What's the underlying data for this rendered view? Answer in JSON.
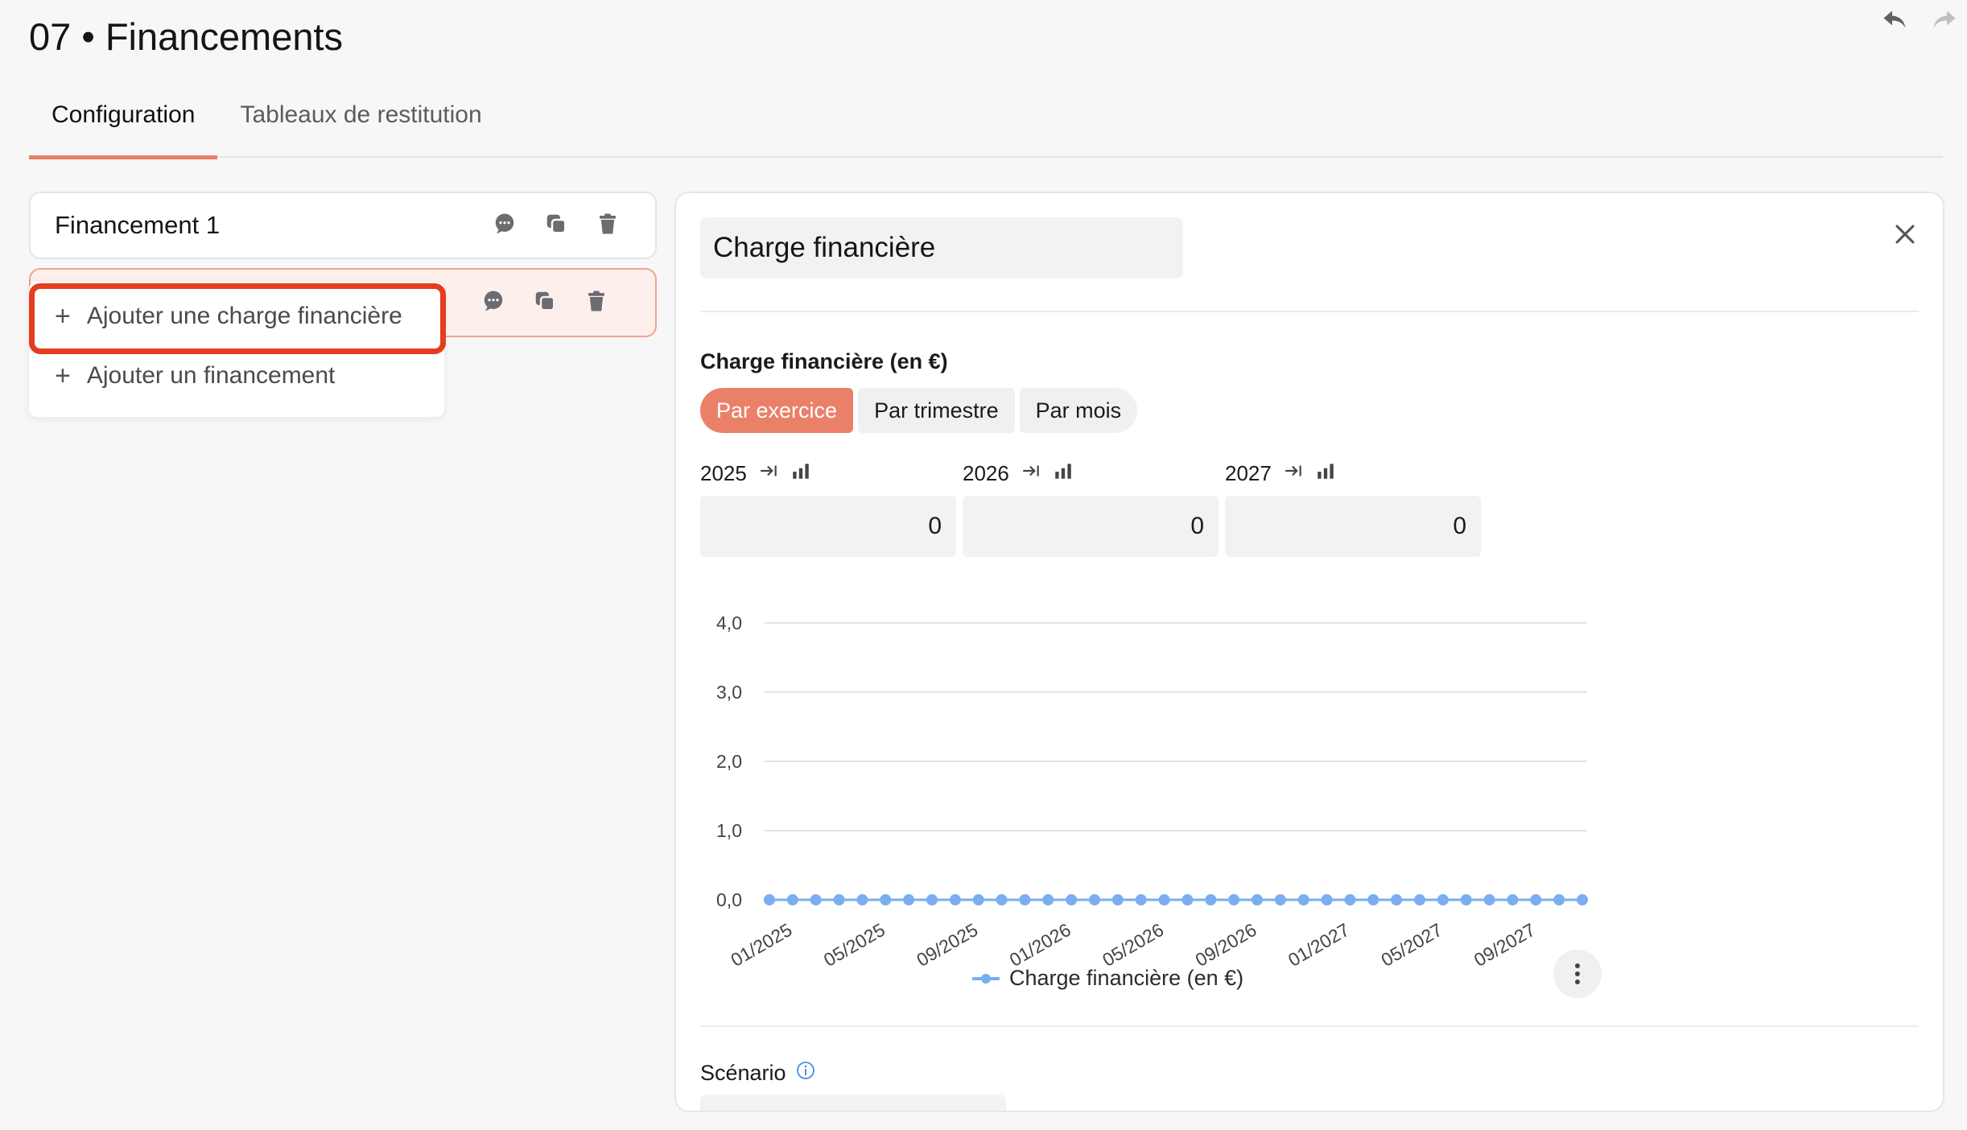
{
  "page": {
    "title": "07 • Financements"
  },
  "tabs": [
    {
      "label": "Configuration",
      "active": true
    },
    {
      "label": "Tableaux de restitution",
      "active": false
    }
  ],
  "financements": [
    {
      "name": "Financement 1"
    }
  ],
  "dropdown": {
    "items": [
      {
        "label": "Ajouter une charge financière"
      },
      {
        "label": "Ajouter un financement"
      }
    ]
  },
  "detail": {
    "name_value": "Charge financière",
    "section_label": "Charge financière (en €)",
    "periods": [
      {
        "label": "Par exercice",
        "active": true
      },
      {
        "label": "Par trimestre",
        "active": false
      },
      {
        "label": "Par mois",
        "active": false
      }
    ],
    "years": [
      {
        "year": "2025",
        "value": "0"
      },
      {
        "year": "2026",
        "value": "0"
      },
      {
        "year": "2027",
        "value": "0"
      }
    ],
    "scenario_label": "Scénario"
  },
  "colors": {
    "accent": "#eb8069",
    "highlight": "#e53c1f",
    "series": "#7aaef0"
  },
  "chart_data": {
    "type": "line",
    "x": [
      "01/2025",
      "02/2025",
      "03/2025",
      "04/2025",
      "05/2025",
      "06/2025",
      "07/2025",
      "08/2025",
      "09/2025",
      "10/2025",
      "11/2025",
      "12/2025",
      "01/2026",
      "02/2026",
      "03/2026",
      "04/2026",
      "05/2026",
      "06/2026",
      "07/2026",
      "08/2026",
      "09/2026",
      "10/2026",
      "11/2026",
      "12/2026",
      "01/2027",
      "02/2027",
      "03/2027",
      "04/2027",
      "05/2027",
      "06/2027",
      "07/2027",
      "08/2027",
      "09/2027",
      "10/2027",
      "11/2027",
      "12/2027"
    ],
    "tick_labels": [
      "01/2025",
      "05/2025",
      "09/2025",
      "01/2026",
      "05/2026",
      "09/2026",
      "01/2027",
      "05/2027",
      "09/2027"
    ],
    "series": [
      {
        "name": "Charge financière (en €)",
        "values": [
          0,
          0,
          0,
          0,
          0,
          0,
          0,
          0,
          0,
          0,
          0,
          0,
          0,
          0,
          0,
          0,
          0,
          0,
          0,
          0,
          0,
          0,
          0,
          0,
          0,
          0,
          0,
          0,
          0,
          0,
          0,
          0,
          0,
          0,
          0,
          0
        ]
      }
    ],
    "y_ticks": [
      "0,0",
      "1,0",
      "2,0",
      "3,0",
      "4,0"
    ],
    "ylim": [
      0,
      4
    ],
    "grid": true,
    "legend": "bottom"
  }
}
